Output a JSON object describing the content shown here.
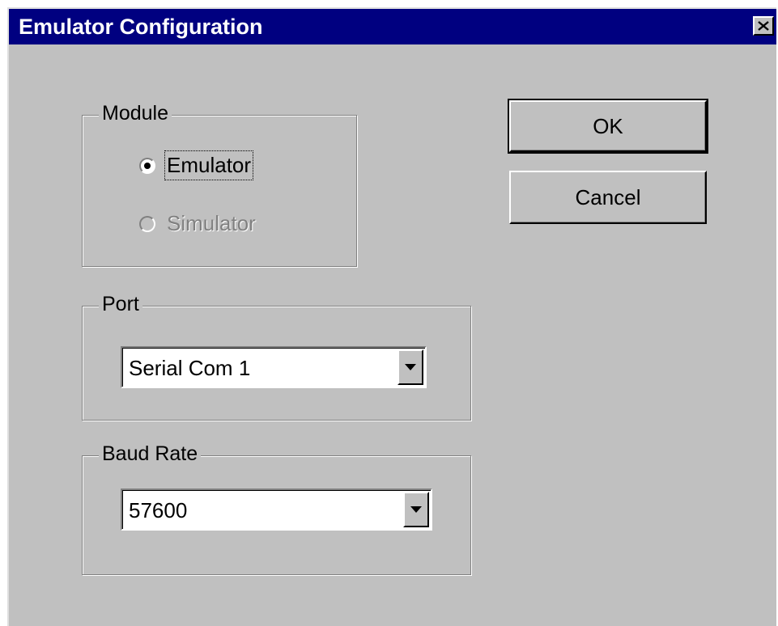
{
  "window": {
    "title": "Emulator Configuration"
  },
  "module": {
    "legend": "Module",
    "options": [
      {
        "label": "Emulator",
        "selected": true,
        "enabled": true
      },
      {
        "label": "Simulator",
        "selected": false,
        "enabled": false
      }
    ]
  },
  "port": {
    "legend": "Port",
    "value": "Serial Com 1"
  },
  "baud": {
    "legend": "Baud Rate",
    "value": "57600"
  },
  "buttons": {
    "ok": "OK",
    "cancel": "Cancel"
  }
}
